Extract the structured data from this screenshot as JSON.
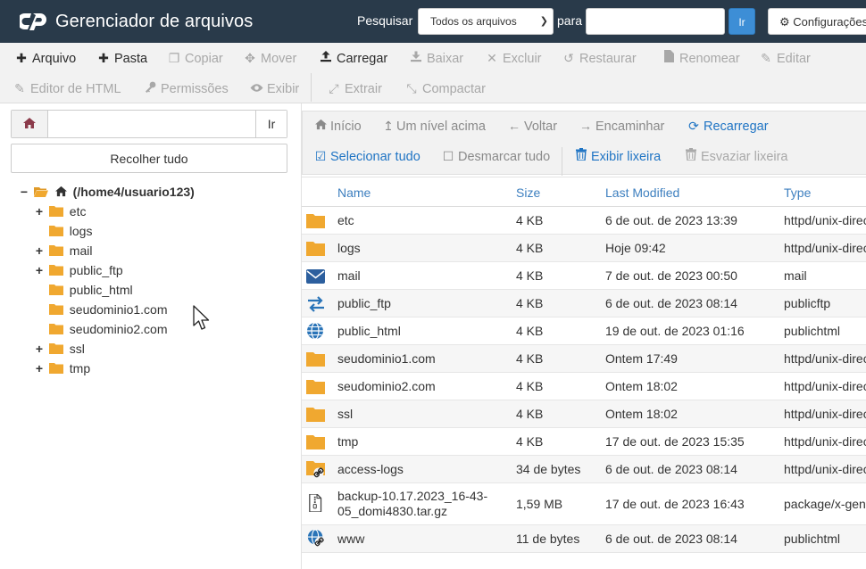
{
  "header": {
    "app_title": "Gerenciador de arquivos",
    "search_label": "Pesquisar",
    "search_scope": "Todos os arquivos",
    "para_label": "para",
    "search_value": "",
    "go_label": "Ir",
    "settings_label": "Configurações"
  },
  "toolbar": {
    "file": "Arquivo",
    "folder": "Pasta",
    "copy": "Copiar",
    "move": "Mover",
    "upload": "Carregar",
    "download": "Baixar",
    "delete": "Excluir",
    "restore": "Restaurar",
    "rename": "Renomear",
    "edit": "Editar",
    "html_editor": "Editor de HTML",
    "permissions": "Permissões",
    "view": "Exibir",
    "extract": "Extrair",
    "compress": "Compactar"
  },
  "left": {
    "path_value": "",
    "path_go": "Ir",
    "collapse_label": "Recolher tudo",
    "tree": {
      "root": "(/home4/usuario123)",
      "items": [
        "etc",
        "logs",
        "mail",
        "public_ftp",
        "public_html",
        "seudominio1.com",
        "seudominio2.com",
        "ssl",
        "tmp"
      ]
    }
  },
  "nav": {
    "home": "Início",
    "up": "Um nível acima",
    "back": "Voltar",
    "forward": "Encaminhar",
    "reload": "Recarregar",
    "select_all": "Selecionar tudo",
    "deselect_all": "Desmarcar tudo",
    "show_trash": "Exibir lixeira",
    "empty_trash": "Esvaziar lixeira"
  },
  "table": {
    "headers": {
      "name": "Name",
      "size": "Size",
      "modified": "Last Modified",
      "type": "Type"
    },
    "rows": [
      {
        "icon": "folder-icon",
        "name": "etc",
        "size": "4 KB",
        "modified": "6 de out. de 2023 13:39",
        "type": "httpd/unix-directory"
      },
      {
        "icon": "folder-icon",
        "name": "logs",
        "size": "4 KB",
        "modified": "Hoje 09:42",
        "type": "httpd/unix-directory"
      },
      {
        "icon": "mail-icon",
        "name": "mail",
        "size": "4 KB",
        "modified": "7 de out. de 2023 00:50",
        "type": "mail"
      },
      {
        "icon": "transfer-arrows-icon",
        "name": "public_ftp",
        "size": "4 KB",
        "modified": "6 de out. de 2023 08:14",
        "type": "publicftp"
      },
      {
        "icon": "globe-icon",
        "name": "public_html",
        "size": "4 KB",
        "modified": "19 de out. de 2023 01:16",
        "type": "publichtml"
      },
      {
        "icon": "folder-icon",
        "name": "seudominio1.com",
        "size": "4 KB",
        "modified": "Ontem 17:49",
        "type": "httpd/unix-directory"
      },
      {
        "icon": "folder-icon",
        "name": "seudominio2.com",
        "size": "4 KB",
        "modified": "Ontem 18:02",
        "type": "httpd/unix-directory"
      },
      {
        "icon": "folder-icon",
        "name": "ssl",
        "size": "4 KB",
        "modified": "Ontem 18:02",
        "type": "httpd/unix-directory"
      },
      {
        "icon": "folder-icon",
        "name": "tmp",
        "size": "4 KB",
        "modified": "17 de out. de 2023 15:35",
        "type": "httpd/unix-directory"
      },
      {
        "icon": "folder-link-icon",
        "name": "access-logs",
        "size": "34 de bytes",
        "modified": "6 de out. de 2023 08:14",
        "type": "httpd/unix-directory"
      },
      {
        "icon": "archive-file-icon",
        "name": "backup-10.17.2023_16-43-05_domi4830.tar.gz",
        "name_line1": "backup-10.17.2023_16-43-",
        "name_line2": "05_domi4830.tar.gz",
        "size": "1,59 MB",
        "modified": "17 de out. de 2023 16:43",
        "type": "package/x-gen"
      },
      {
        "icon": "globe-link-icon",
        "name": "www",
        "size": "11 de bytes",
        "modified": "6 de out. de 2023 08:14",
        "type": "publichtml"
      }
    ]
  },
  "colors": {
    "topbar": "#293a4a",
    "accent": "#3d8ed6",
    "folder": "#f0a830",
    "link_blue": "#1f74c4",
    "header_text": "#3d7fbf"
  }
}
